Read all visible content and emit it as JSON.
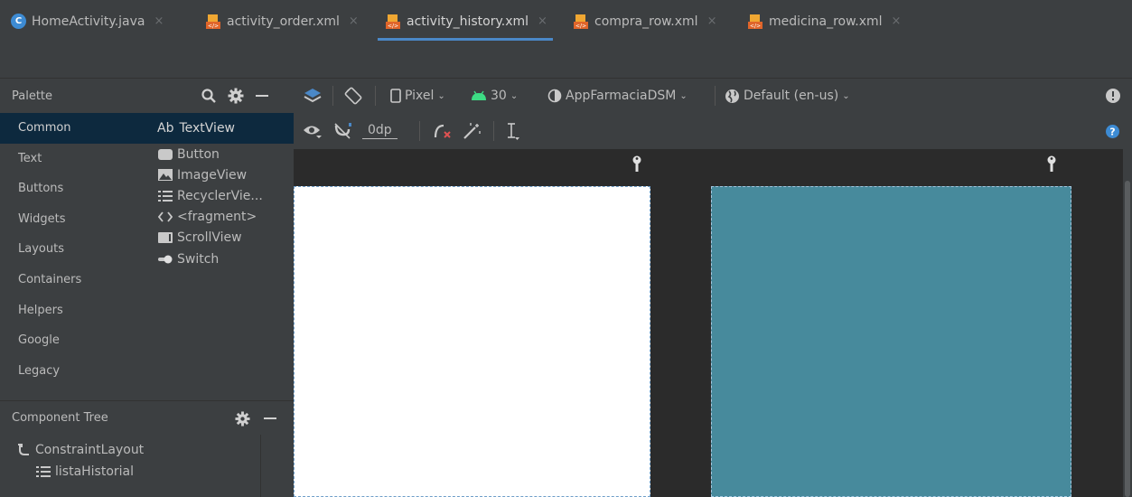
{
  "tabs": [
    {
      "label": "HomeActivity.java",
      "icon": "java-class-icon",
      "active": false
    },
    {
      "label": "activity_order.xml",
      "icon": "layout-xml-icon",
      "active": false
    },
    {
      "label": "activity_history.xml",
      "icon": "layout-xml-icon",
      "active": true
    },
    {
      "label": "compra_row.xml",
      "icon": "layout-xml-icon",
      "active": false
    },
    {
      "label": "medicina_row.xml",
      "icon": "layout-xml-icon",
      "active": false
    }
  ],
  "tab_close": "×",
  "palette": {
    "title": "Palette",
    "categories": [
      "Common",
      "Text",
      "Buttons",
      "Widgets",
      "Layouts",
      "Containers",
      "Helpers",
      "Google",
      "Legacy"
    ],
    "widgets": [
      {
        "label": "TextView",
        "prefix": "Ab",
        "icon": "textview-icon"
      },
      {
        "label": "Button",
        "icon": "button-icon"
      },
      {
        "label": "ImageView",
        "icon": "image-icon"
      },
      {
        "label": "RecyclerVie...",
        "icon": "list-icon"
      },
      {
        "label": "<fragment>",
        "icon": "code-brackets-icon"
      },
      {
        "label": "ScrollView",
        "icon": "scrollview-icon"
      },
      {
        "label": "Switch",
        "icon": "switch-icon"
      }
    ]
  },
  "component_tree": {
    "title": "Component Tree",
    "nodes": [
      {
        "label": "ConstraintLayout",
        "icon": "constraint-layout-icon",
        "level": 0
      },
      {
        "label": "listaHistorial",
        "icon": "list-icon",
        "level": 1
      }
    ]
  },
  "toolbar": {
    "device": "Pixel",
    "api": "30",
    "theme": "AppFarmaciaDSM",
    "locale": "Default (en-us)",
    "margin": "0dp"
  },
  "colors": {
    "accent": "#4a88c7",
    "blueprint": "#478a9c",
    "selection": "#0d293e",
    "android_green": "#3ddc84"
  }
}
